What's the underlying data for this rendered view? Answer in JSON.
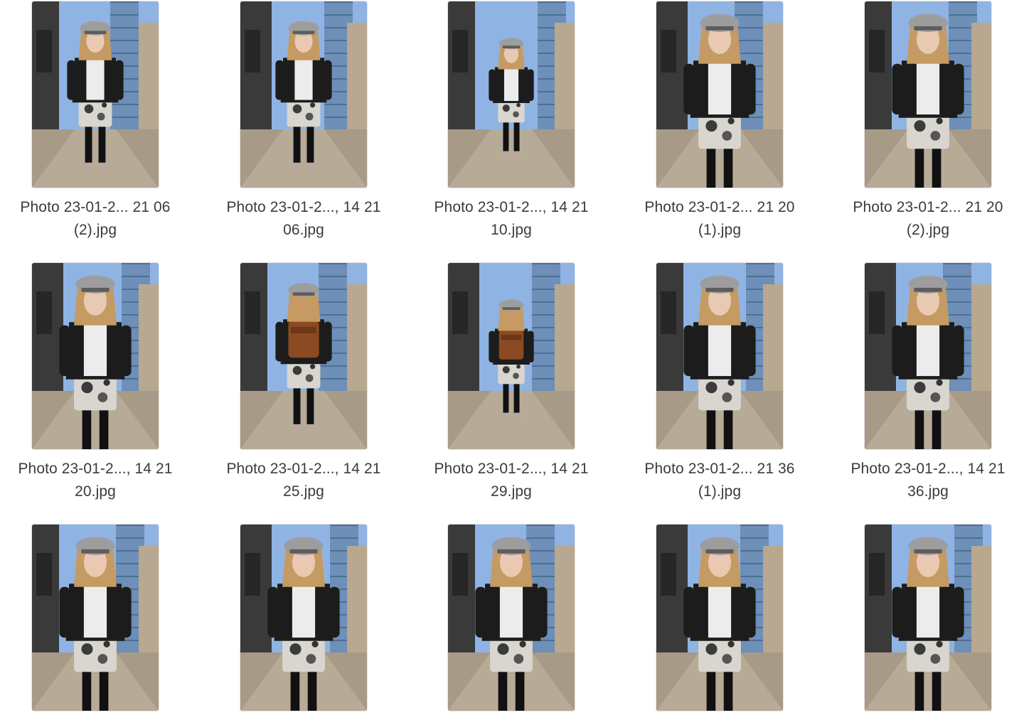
{
  "files": [
    {
      "line1": "Photo 23-01-2... 21 06",
      "line2": "(2).jpg",
      "scene": "walk",
      "bag": false
    },
    {
      "line1": "Photo 23-01-2..., 14 21",
      "line2": "06.jpg",
      "scene": "walk",
      "bag": false
    },
    {
      "line1": "Photo 23-01-2..., 14 21",
      "line2": "10.jpg",
      "scene": "walk-far",
      "bag": false
    },
    {
      "line1": "Photo 23-01-2... 21 20",
      "line2": "(1).jpg",
      "scene": "close",
      "bag": false
    },
    {
      "line1": "Photo 23-01-2... 21 20",
      "line2": "(2).jpg",
      "scene": "close",
      "bag": false
    },
    {
      "line1": "Photo 23-01-2..., 14 21",
      "line2": "20.jpg",
      "scene": "close",
      "bag": false
    },
    {
      "line1": "Photo 23-01-2..., 14 21",
      "line2": "25.jpg",
      "scene": "back",
      "bag": true
    },
    {
      "line1": "Photo 23-01-2..., 14 21",
      "line2": "29.jpg",
      "scene": "back-far",
      "bag": true
    },
    {
      "line1": "Photo 23-01-2... 21 36",
      "line2": "(1).jpg",
      "scene": "close",
      "bag": false
    },
    {
      "line1": "Photo 23-01-2..., 14 21",
      "line2": "36.jpg",
      "scene": "close",
      "bag": false
    },
    {
      "line1": "",
      "line2": "",
      "scene": "close",
      "bag": false
    },
    {
      "line1": "",
      "line2": "",
      "scene": "close",
      "bag": false
    },
    {
      "line1": "",
      "line2": "",
      "scene": "close",
      "bag": false
    },
    {
      "line1": "",
      "line2": "",
      "scene": "close",
      "bag": false
    },
    {
      "line1": "",
      "line2": "",
      "scene": "close",
      "bag": false
    }
  ],
  "colors": {
    "sky": "#8fb4e3",
    "building": "#3a3a3a",
    "tower": "#6d8fb8",
    "pavement": "#a79a87",
    "jacket": "#1c1c1c",
    "shirt": "#ececec",
    "hair": "#c59a63",
    "cap": "#9d9d9d",
    "skirt": "#d8d6cf",
    "bag": "#8c4a22"
  }
}
